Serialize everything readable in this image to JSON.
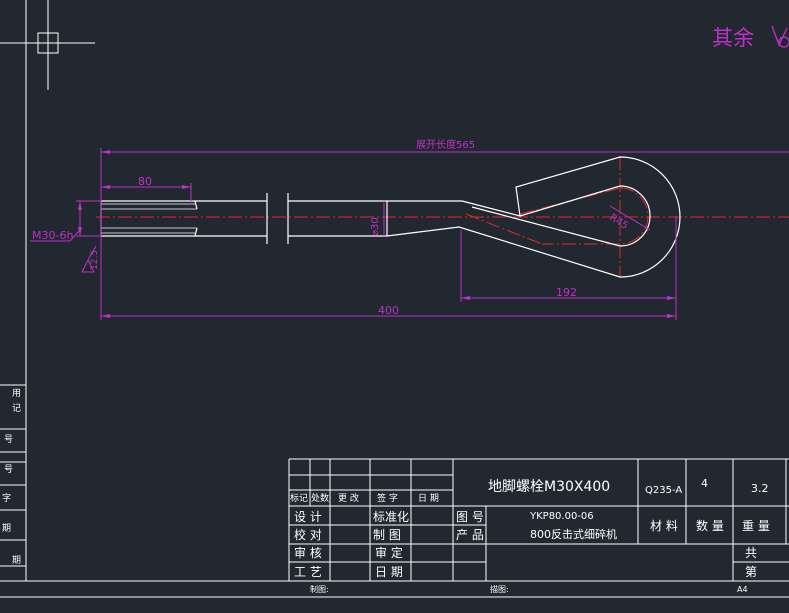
{
  "corner_note": "其余",
  "dimensions": {
    "unfolded_length": "展开长度565",
    "thread_length": "80",
    "thread_spec": "M30-6h",
    "shank_diameter": "⌀30",
    "eye_radius": "R45",
    "bend_length": "192",
    "total_length": "400",
    "roughness": "12.5"
  },
  "title_block": {
    "part_name": "地脚螺栓M30X400",
    "material": "Q235-A",
    "quantity": "4",
    "weight": "3.2",
    "revision_headers": [
      "标记",
      "处数",
      "更 改",
      "签 字",
      "日 期"
    ],
    "labels": {
      "design": "设 计",
      "standardize": "标准化",
      "drawing_no_label": "图 号",
      "check": "校 对",
      "draft": "制 图",
      "product_label": "产 品",
      "review": "审 核",
      "approve": "审 定",
      "process": "工 艺",
      "date": "日 期",
      "material_label": "材 料",
      "quantity_label": "数 量",
      "weight_label": "重 量",
      "total_sheets": "共",
      "sheet_no": "第"
    },
    "drawing_no": "YKP80.00-06",
    "product": "800反击式细碎机"
  },
  "left_strip": [
    "用",
    "记",
    "号",
    "号",
    "字",
    "期",
    "期"
  ],
  "bottom_bar": {
    "drawer": "制图:",
    "tracer": "描图:",
    "format": "A4"
  }
}
